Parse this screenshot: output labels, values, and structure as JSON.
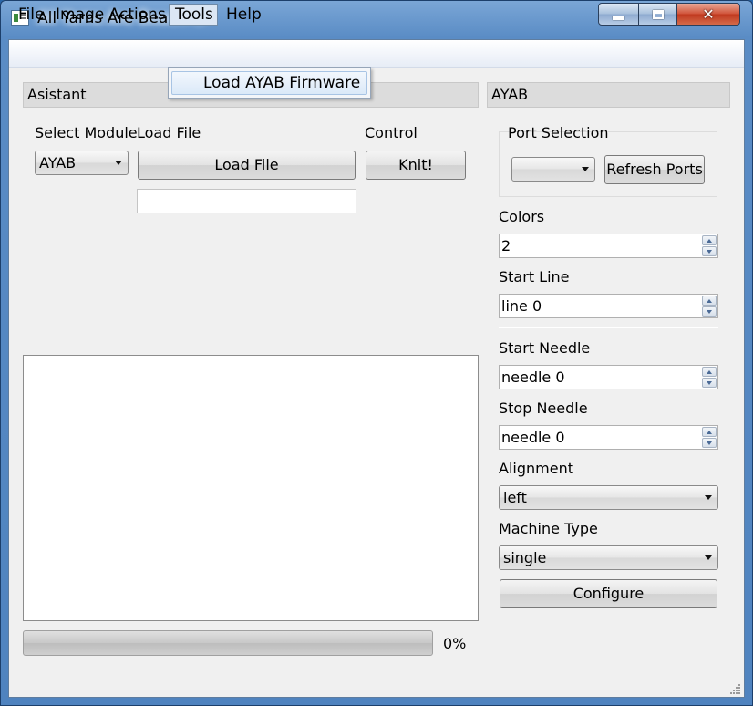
{
  "window": {
    "title": "All Yarns Are Beautiful"
  },
  "menubar": {
    "file": "File",
    "image_actions": "Image Actions",
    "tools": "Tools",
    "help": "Help"
  },
  "tools_menu": {
    "items": [
      "Load AYAB Firmware"
    ]
  },
  "asistant": {
    "header": "Asistant",
    "select_module_label": "Select Module",
    "select_module_value": "AYAB",
    "load_file_label": "Load File",
    "load_file_button": "Load File",
    "file_path_value": "",
    "control_label": "Control",
    "knit_button": "Knit!"
  },
  "progress": {
    "value": 0,
    "text": "0%"
  },
  "ayab": {
    "header": "AYAB",
    "port_selection_label": "Port Selection",
    "port_value": "",
    "refresh_ports_button": "Refresh Ports",
    "colors_label": "Colors",
    "colors_value": "2",
    "start_line_label": "Start Line",
    "start_line_value": "line 0",
    "start_needle_label": "Start Needle",
    "start_needle_value": "needle 0",
    "stop_needle_label": "Stop Needle",
    "stop_needle_value": "needle 0",
    "alignment_label": "Alignment",
    "alignment_value": "left",
    "machine_type_label": "Machine Type",
    "machine_type_value": "single",
    "configure_button": "Configure"
  },
  "colors": {
    "progress_fill": "#3cb043",
    "title_bar": "#5a8cc5",
    "close_button": "#c0391f"
  }
}
